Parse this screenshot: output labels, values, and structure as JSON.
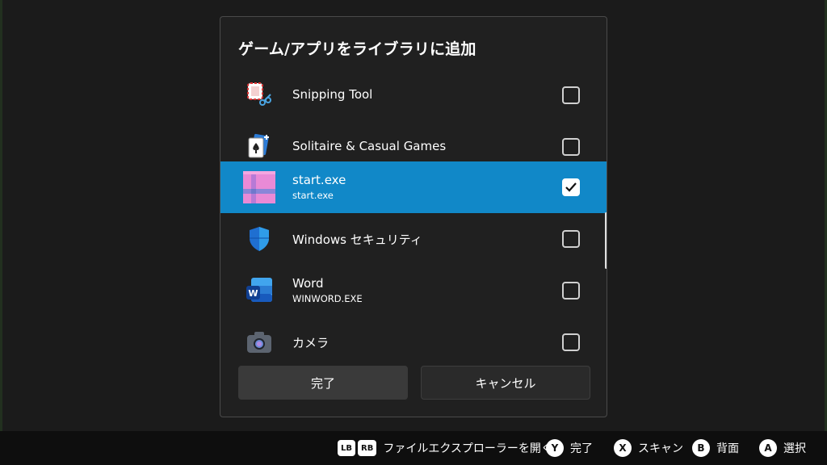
{
  "dialog": {
    "title": "ゲーム/アプリをライブラリに追加",
    "items": [
      {
        "name": "Snipping Tool",
        "sub": "",
        "checked": false,
        "icon": "snipping-tool-icon"
      },
      {
        "name": "Solitaire & Casual Games",
        "sub": "",
        "checked": false,
        "icon": "solitaire-icon"
      },
      {
        "name": "start.exe",
        "sub": "start.exe",
        "checked": true,
        "icon": "start-exe-icon"
      },
      {
        "name": "Windows セキュリティ",
        "sub": "",
        "checked": false,
        "icon": "windows-security-shield-icon"
      },
      {
        "name": "Word",
        "sub": "WINWORD.EXE",
        "checked": false,
        "icon": "word-icon"
      },
      {
        "name": "カメラ",
        "sub": "",
        "checked": false,
        "icon": "camera-icon"
      }
    ],
    "done_label": "完了",
    "cancel_label": "キャンセル"
  },
  "footer": {
    "lb": "LB",
    "rb": "RB",
    "open_explorer": "ファイルエクスプローラーを開く",
    "y_key": "Y",
    "y_label": "完了",
    "x_key": "X",
    "x_label": "スキャン",
    "b_key": "B",
    "b_label": "背面",
    "a_key": "A",
    "a_label": "選択"
  },
  "colors": {
    "selected_row": "#1188c8",
    "dialog_bg": "#202020"
  }
}
